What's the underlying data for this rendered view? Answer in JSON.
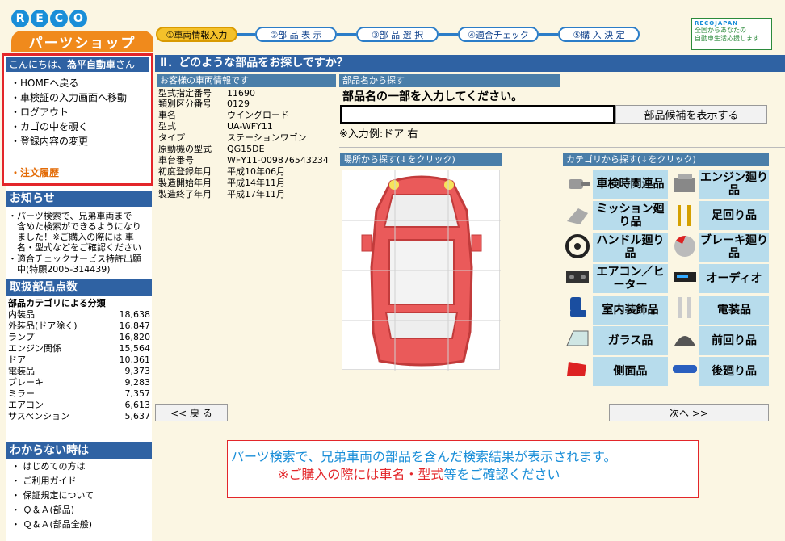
{
  "logo": {
    "letters": [
      "R",
      "E",
      "C",
      "O"
    ],
    "sub": "パーツショップ"
  },
  "steps": [
    "①車両情報入力",
    "②部 品 表 示",
    "③部 品 選 択",
    "④適合チェック",
    "⑤購 入 決 定"
  ],
  "badge": {
    "title": "RECOJAPAN",
    "line1": "全国からあなたの",
    "line2": "自動車生活応援します"
  },
  "user": {
    "greeting_prefix": "こんにちは、",
    "greeting_name": "為平自動車",
    "greeting_suffix": "さん",
    "menu": [
      "・HOMEへ戻る",
      "・車検証の入力画面へ移動",
      "・ログアウト",
      "・カゴの中を覗く",
      "・登録内容の変更"
    ],
    "order_history": "・注文履歴"
  },
  "news": {
    "title": "お知らせ",
    "items": [
      "・パーツ検索で、兄弟車両まで",
      "　含めた検索ができるようになり",
      "　ました！※ご購入の際には 車",
      "　名・型式などをご確認ください",
      "・適合チェックサービス特許出願",
      "　中(特願2005-314439)"
    ]
  },
  "counts": {
    "title": "取扱部品点数",
    "subtitle": "部品カテゴリによる分類",
    "rows": [
      {
        "name": "内装品",
        "value": "18,638"
      },
      {
        "name": "外装品(ドア除く)",
        "value": "16,847"
      },
      {
        "name": "ランプ",
        "value": "16,820"
      },
      {
        "name": "エンジン関係",
        "value": "15,564"
      },
      {
        "name": "ドア",
        "value": "10,361"
      },
      {
        "name": "電装品",
        "value": "9,373"
      },
      {
        "name": "ブレーキ",
        "value": "9,283"
      },
      {
        "name": "ミラー",
        "value": "7,357"
      },
      {
        "name": "エアコン",
        "value": "6,613"
      },
      {
        "name": "サスペンション",
        "value": "5,637"
      }
    ]
  },
  "help": {
    "title": "わからない時は",
    "items": [
      "・ はじめての方は",
      "・ ご利用ガイド",
      "・ 保証規定について",
      "・ Ｑ＆Ａ(部品)",
      "・ Ｑ＆Ａ(部品全般)"
    ]
  },
  "main": {
    "title": "Ⅱ．どのような部品をお探しですか？",
    "vehicle_label": "お客様の車両情報です",
    "vehicle": [
      {
        "k": "型式指定番号",
        "v": "11690"
      },
      {
        "k": "類別区分番号",
        "v": "0129"
      },
      {
        "k": "車名",
        "v": "ウイングロード"
      },
      {
        "k": "型式",
        "v": "UA-WFY11"
      },
      {
        "k": "タイプ",
        "v": "ステーションワゴン"
      },
      {
        "k": "原動機の型式",
        "v": "QG15DE"
      },
      {
        "k": "車台番号",
        "v": "WFY11-009876543234"
      },
      {
        "k": "初度登録年月",
        "v": "平成10年06月"
      },
      {
        "k": "製造開始年月",
        "v": "平成14年11月"
      },
      {
        "k": "製造終了年月",
        "v": "平成17年11月"
      }
    ],
    "name_search_label": "部品名から探す",
    "name_search_instr": "部品名の一部を入力してください。",
    "name_search_value": "",
    "suggest_button": "部品候補を表示する",
    "name_search_example": "※入力例:ドア 右",
    "location_label": "場所から探す(↓をクリック)",
    "category_label": "カテゴリから探す(↓をクリック)",
    "categories": [
      "車検時関連品",
      "エンジン廻り品",
      "ミッション廻り品",
      "足回り品",
      "ハンドル廻り品",
      "ブレーキ廻り品",
      "エアコン／ヒーター",
      "オーディオ",
      "室内装飾品",
      "電装品",
      "ガラス品",
      "前回り品",
      "側面品",
      "後廻り品"
    ],
    "back_button": "<< 戻 る",
    "next_button": "次へ >>",
    "notice_line1": "パーツ検索で、兄弟車両の部品を含んだ検索結果が表示されます。",
    "notice_line2_a": "※ご購入の際には",
    "notice_line2_b": "車名・型式",
    "notice_line2_c": "等をご確認ください"
  }
}
